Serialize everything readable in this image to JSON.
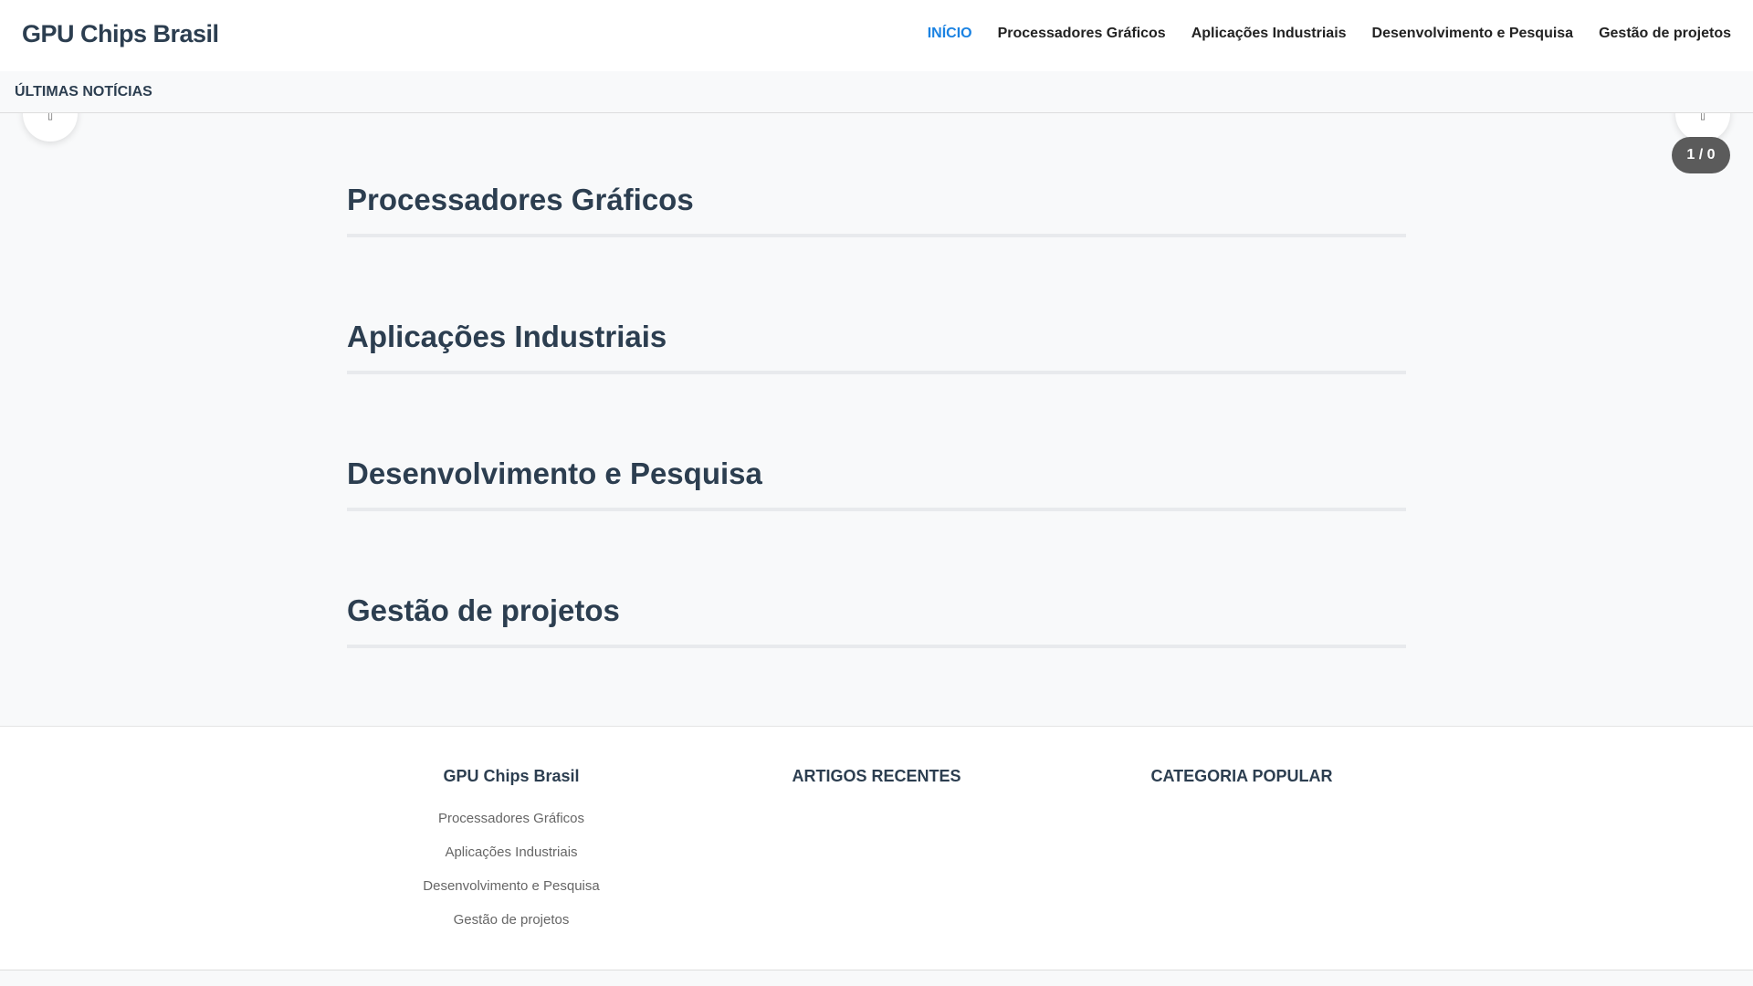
{
  "header": {
    "logo": "GPU Chips Brasil",
    "nav": [
      "INÍCIO",
      "Processadores Gráficos",
      "Aplicações Industriais",
      "Desenvolvimento e Pesquisa",
      "Gestão de projetos"
    ]
  },
  "ticker": {
    "label": "ÚLTIMAS NOTÍCIAS",
    "prev_icon": "▯",
    "next_icon": "▯",
    "counter": "1 / 0"
  },
  "sections": [
    "Processadores Gráficos",
    "Aplicações Industriais",
    "Desenvolvimento e Pesquisa",
    "Gestão de projetos"
  ],
  "footer": {
    "col1_title": "GPU Chips Brasil",
    "col1_links": [
      "Processadores Gráficos",
      "Aplicações Industriais",
      "Desenvolvimento e Pesquisa",
      "Gestão de projetos"
    ],
    "col2_title": "ARTIGOS RECENTES",
    "col3_title": "CATEGORIA POPULAR"
  },
  "colors": {
    "accent": "#1a82e2",
    "heading": "#2c3e50"
  }
}
